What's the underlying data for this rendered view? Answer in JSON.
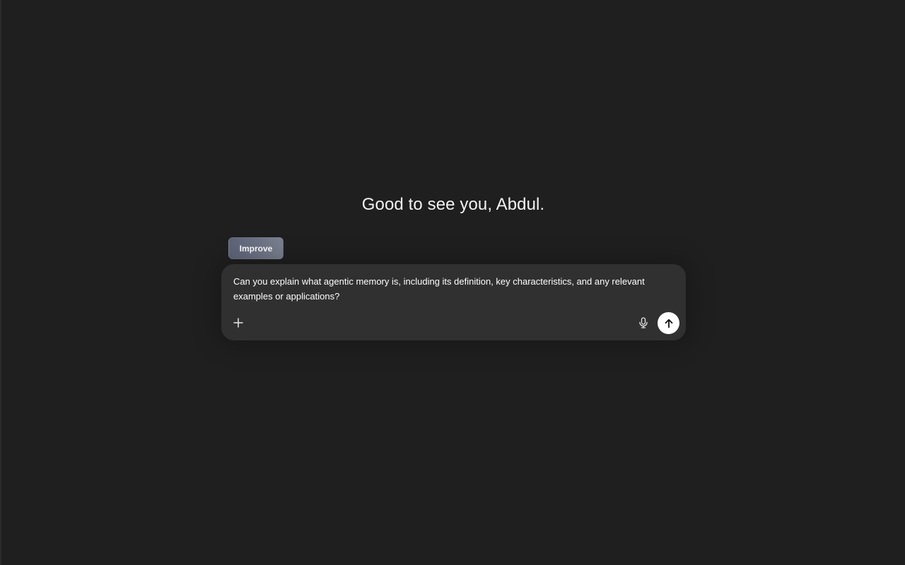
{
  "greeting": "Good to see you, Abdul.",
  "improve_button": {
    "label": "Improve"
  },
  "composer": {
    "text": "Can you explain what agentic memory is, including its definition, key characteristics, and any relevant examples or applications?",
    "icons": {
      "add": "plus-icon",
      "mic": "microphone-icon",
      "send": "arrow-up-icon"
    }
  },
  "colors": {
    "background": "#1f1f1f",
    "composer_background": "#303030",
    "improve_gradient_start": "#5d6478",
    "improve_gradient_end": "#7b8090",
    "send_button": "#ffffff"
  }
}
